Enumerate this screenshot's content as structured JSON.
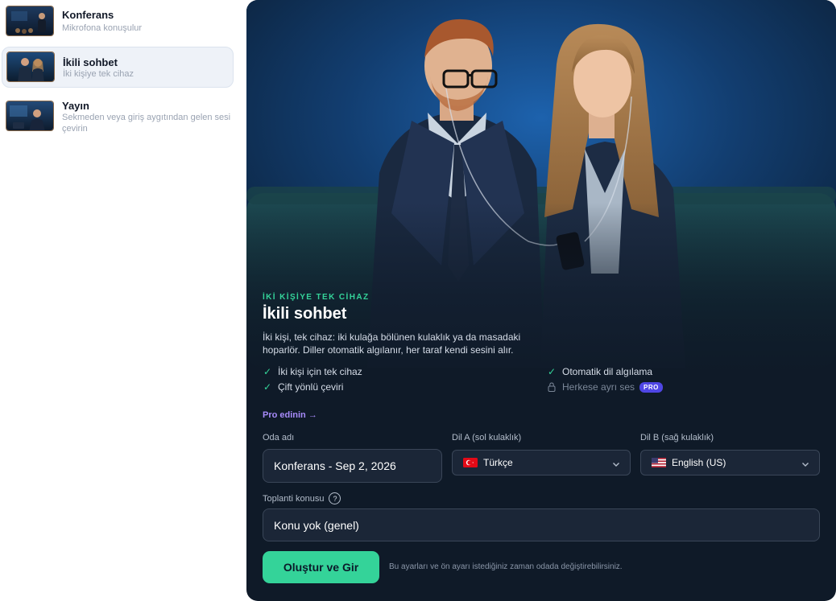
{
  "sidebar": {
    "items": [
      {
        "title": "Konferans",
        "desc": "Mikrofona konuşulur"
      },
      {
        "title": "İkili sohbet",
        "desc": "İki kişiye tek cihaz"
      },
      {
        "title": "Yayın",
        "desc": "Sekmeden veya giriş aygıtından gelen sesi çevirin"
      }
    ]
  },
  "panel": {
    "eyebrow": "İKİ KİŞİYE TEK CİHAZ",
    "title": "İkili sohbet",
    "intro": "İki kişi, tek cihaz: iki kulağa bölünen kulaklık ya da masadaki hoparlör. Diller otomatik algılanır, her taraf kendi sesini alır.",
    "features": {
      "f1": "İki kişi için tek cihaz",
      "f2": "Çift yönlü çeviri",
      "f3": "Otomatik dil algılama",
      "f4": "Herkese ayrı ses"
    },
    "pro_badge": "PRO",
    "pro_link": "Pro edinin →",
    "room_label": "Oda adı",
    "room_value": "Konferans - Sep 2, 2026",
    "lang_a_label": "Dil A (sol kulaklık)",
    "lang_a_value": "Türkçe",
    "lang_b_label": "Dil B (sağ kulaklık)",
    "lang_b_value": "English (US)",
    "topic_label": "Toplanti konusu",
    "help_glyph": "?",
    "topic_value": "Konu yok (genel)",
    "cta": "Oluştur ve Gir",
    "cta_hint": "Bu ayarları ve ön ayarı istediğiniz zaman odada değiştirebilirsiniz."
  },
  "colors": {
    "accent": "#34d399",
    "panel_bg": "#0f1a28",
    "pro": "#4f46e5",
    "link": "#a78bfa"
  },
  "icons": [
    "check-icon",
    "lock-icon",
    "chevron-down-icon",
    "help-icon",
    "tr-flag-icon",
    "us-flag-icon"
  ]
}
